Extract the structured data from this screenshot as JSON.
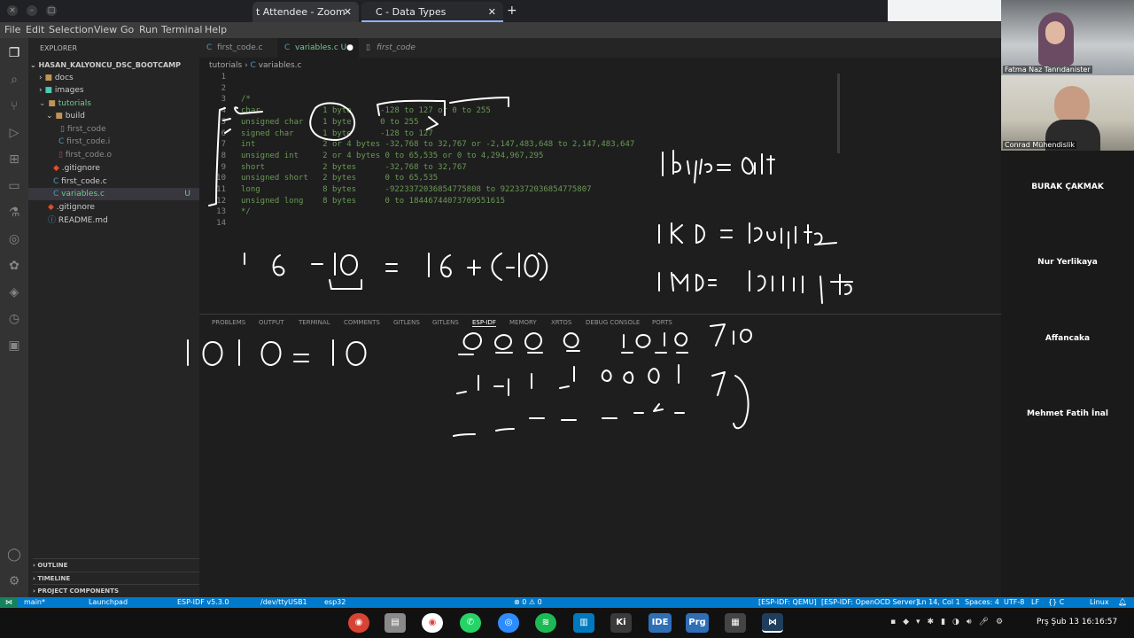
{
  "browser": {
    "tabs": [
      {
        "label": "t Attendee - Zoom"
      },
      {
        "label": "C - Data Types"
      }
    ],
    "new_tab": "+"
  },
  "menu": [
    "File",
    "Edit",
    "Selection",
    "View",
    "Go",
    "Run",
    "Terminal",
    "Help"
  ],
  "sidebar": {
    "title": "EXPLORER",
    "root": "HASAN_KALYONCU_DSC_BOOTCAMP",
    "items": [
      {
        "label": "docs"
      },
      {
        "label": "images"
      },
      {
        "label": "tutorials"
      },
      {
        "label": "build"
      },
      {
        "label": "first_code"
      },
      {
        "label": "first_code.i"
      },
      {
        "label": "first_code.o"
      },
      {
        "label": ".gitignore"
      },
      {
        "label": "first_code.c"
      },
      {
        "label": "variables.c",
        "badge": "U"
      },
      {
        "label": ".gitignore"
      },
      {
        "label": "README.md"
      }
    ],
    "sections": [
      "OUTLINE",
      "TIMELINE",
      "PROJECT COMPONENTS"
    ]
  },
  "editor": {
    "tabs": [
      {
        "label": "first_code.c"
      },
      {
        "label": "variables.c U"
      },
      {
        "label": "first_code"
      }
    ],
    "breadcrumb": [
      "tutorials",
      "variables.c"
    ],
    "lines": [
      {
        "n": "1",
        "text": ""
      },
      {
        "n": "2",
        "text": ""
      },
      {
        "n": "3",
        "text": "/*"
      },
      {
        "n": "4",
        "text": "char             1 byte      -128 to 127 or 0 to 255"
      },
      {
        "n": "5",
        "text": "unsigned char    1 byte      0 to 255"
      },
      {
        "n": "6",
        "text": "signed char      1 byte      -128 to 127"
      },
      {
        "n": "7",
        "text": "int              2 or 4 bytes -32,768 to 32,767 or -2,147,483,648 to 2,147,483,647"
      },
      {
        "n": "8",
        "text": "unsigned int     2 or 4 bytes 0 to 65,535 or 0 to 4,294,967,295"
      },
      {
        "n": "9",
        "text": "short            2 bytes      -32,768 to 32,767"
      },
      {
        "n": "10",
        "text": "unsigned short   2 bytes      0 to 65,535"
      },
      {
        "n": "11",
        "text": "long             8 bytes      -9223372036854775808 to 9223372036854775807"
      },
      {
        "n": "12",
        "text": "unsigned long    8 bytes      0 to 18446744073709551615"
      },
      {
        "n": "13",
        "text": "*/"
      },
      {
        "n": "14",
        "text": ""
      }
    ]
  },
  "panel": {
    "tabs": [
      "PROBLEMS",
      "OUTPUT",
      "TERMINAL",
      "COMMENTS",
      "GITLENS",
      "GITLENS",
      "ESP-IDF",
      "MEMORY",
      "XRTOS",
      "DEBUG CONSOLE",
      "PORTS"
    ],
    "active_tab": "ESP-IDF"
  },
  "participants": {
    "video": [
      {
        "name": "Fatma Naz Tanrıdanister"
      },
      {
        "name": "Conrad Mühendislik"
      }
    ],
    "names": [
      "BURAK ÇAKMAK",
      "Nur Yerlikaya",
      "Affancaka",
      "Mehmet Fatih İnal"
    ]
  },
  "statusbar": {
    "left": [
      "main*",
      "Launchpad",
      "ESP-IDF v5.3.0",
      "/dev/ttyUSB1",
      "esp32",
      "⊗ 0 ⚠ 0"
    ],
    "right": [
      "[ESP-IDF: QEMU]",
      "[ESP-IDF: OpenOCD Server]",
      "Ln 14, Col 1",
      "Spaces: 4",
      "UTF-8",
      "LF",
      "{} C",
      "Linux"
    ]
  },
  "taskbar": {
    "apps": [
      "IDE",
      "Prg",
      "Ki"
    ],
    "clock": "Prş Şub 13  16:16:57"
  },
  "colors": {
    "accent": "#007acc",
    "comment_green": "#6a9955"
  }
}
